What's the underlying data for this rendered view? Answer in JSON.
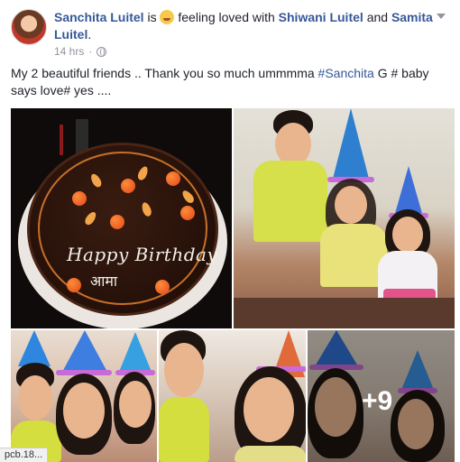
{
  "post": {
    "author": "Sanchita Luitel",
    "is_text": "is",
    "feeling_text": "feeling loved with",
    "tagged_1": "Shiwani Luitel",
    "and_text": "and",
    "tagged_2": "Samita Luitel",
    "period": ".",
    "timestamp": "14 hrs",
    "dot": "·",
    "message_before": "My 2 beautiful friends .. Thank you so much ummmma ",
    "hashtag": "#Sanchita",
    "message_after": " G # baby says love# yes ....",
    "privacy_icon": "globe-icon",
    "menu_icon": "chevron-down-icon"
  },
  "photos": {
    "cake_text": "Happy Birthday",
    "cake_sub": "आमा",
    "more_count": "+9"
  },
  "status_bar": {
    "url": "pcb.18..."
  },
  "colors": {
    "link": "#365899",
    "meta": "#90949c",
    "text": "#1d2129"
  }
}
